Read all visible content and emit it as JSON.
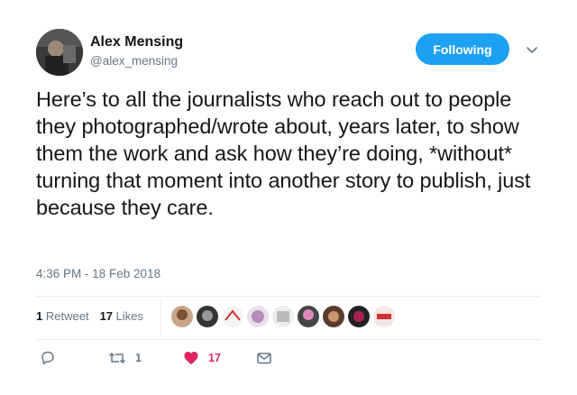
{
  "author": {
    "name": "Alex Mensing",
    "handle": "@alex_mensing"
  },
  "follow_button": {
    "label": "Following"
  },
  "tweet": {
    "text": "Here’s to all the journalists who reach out to people they photographed/wrote about, years later, to show them the work and ask how they’re doing, *without* turning that moment into another story to publish, just because they care.",
    "timestamp": "4:36 PM - 18 Feb 2018"
  },
  "stats": {
    "retweets": "1",
    "retweets_label": "Retweet",
    "likes": "17",
    "likes_label": "Likes"
  },
  "actions": {
    "reply_icon": "reply-icon",
    "retweet_icon": "retweet-icon",
    "retweet_count": "1",
    "like_icon": "heart-icon",
    "like_count": "17",
    "dm_icon": "envelope-icon"
  },
  "colors": {
    "accent": "#1da1f2",
    "like": "#e0245e",
    "secondary_text": "#657786"
  }
}
